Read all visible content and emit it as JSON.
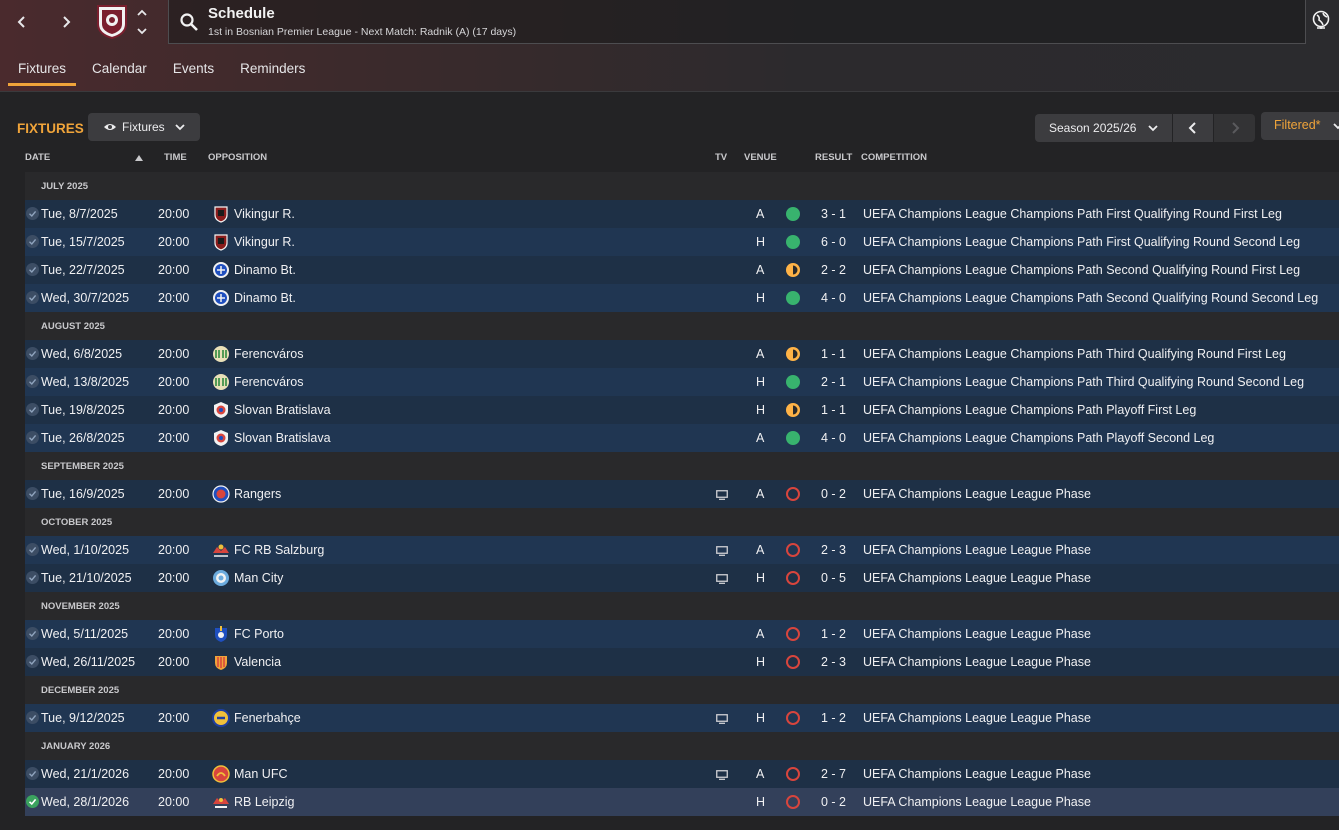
{
  "header": {
    "title": "Schedule",
    "subtitle": "1st in Bosnian Premier League - Next Match: Radnik (A) (17 days)"
  },
  "tabs": [
    "Fixtures",
    "Calendar",
    "Events",
    "Reminders"
  ],
  "section": {
    "title": "FIXTURES",
    "view_dropdown": "Fixtures",
    "season": "Season 2025/26",
    "filter": "Filtered*"
  },
  "columns": {
    "date": "DATE",
    "time": "TIME",
    "opposition": "OPPOSITION",
    "tv": "TV",
    "venue": "VENUE",
    "result": "RESULT",
    "competition": "COMPETITION"
  },
  "colors": {
    "accent": "#f0a43a",
    "win": "#38b36e",
    "draw": "#ffb347",
    "loss": "#d8453d"
  },
  "groups": [
    {
      "label": "JULY 2025",
      "fixtures": [
        {
          "date": "Tue, 8/7/2025",
          "time": "20:00",
          "opp": "Vikingur R.",
          "crest": "vikingur-crest-icon",
          "tv": false,
          "venue": "A",
          "outcome": "w",
          "result": "3 - 1",
          "comp": "UEFA Champions League Champions Path First Qualifying Round First Leg"
        },
        {
          "date": "Tue, 15/7/2025",
          "time": "20:00",
          "opp": "Vikingur R.",
          "crest": "vikingur-crest-icon",
          "tv": false,
          "venue": "H",
          "outcome": "w",
          "result": "6 - 0",
          "comp": "UEFA Champions League Champions Path First Qualifying Round Second Leg"
        },
        {
          "date": "Tue, 22/7/2025",
          "time": "20:00",
          "opp": "Dinamo Bt.",
          "crest": "dinamo-crest-icon",
          "tv": false,
          "venue": "A",
          "outcome": "d",
          "result": "2 - 2",
          "comp": "UEFA Champions League Champions Path Second Qualifying Round First Leg"
        },
        {
          "date": "Wed, 30/7/2025",
          "time": "20:00",
          "opp": "Dinamo Bt.",
          "crest": "dinamo-crest-icon",
          "tv": false,
          "venue": "H",
          "outcome": "w",
          "result": "4 - 0",
          "comp": "UEFA Champions League Champions Path Second Qualifying Round Second Leg"
        }
      ]
    },
    {
      "label": "AUGUST 2025",
      "fixtures": [
        {
          "date": "Wed, 6/8/2025",
          "time": "20:00",
          "opp": "Ferencváros",
          "crest": "ferencvaros-crest-icon",
          "tv": false,
          "venue": "A",
          "outcome": "d",
          "result": "1 - 1",
          "comp": "UEFA Champions League Champions Path Third Qualifying Round First Leg"
        },
        {
          "date": "Wed, 13/8/2025",
          "time": "20:00",
          "opp": "Ferencváros",
          "crest": "ferencvaros-crest-icon",
          "tv": false,
          "venue": "H",
          "outcome": "w",
          "result": "2 - 1",
          "comp": "UEFA Champions League Champions Path Third Qualifying Round Second Leg"
        },
        {
          "date": "Tue, 19/8/2025",
          "time": "20:00",
          "opp": "Slovan Bratislava",
          "crest": "slovan-crest-icon",
          "tv": false,
          "venue": "H",
          "outcome": "d",
          "result": "1 - 1",
          "comp": "UEFA Champions League Champions Path Playoff First Leg"
        },
        {
          "date": "Tue, 26/8/2025",
          "time": "20:00",
          "opp": "Slovan Bratislava",
          "crest": "slovan-crest-icon",
          "tv": false,
          "venue": "A",
          "outcome": "w",
          "result": "4 - 0",
          "comp": "UEFA Champions League Champions Path Playoff Second Leg"
        }
      ]
    },
    {
      "label": "SEPTEMBER 2025",
      "fixtures": [
        {
          "date": "Tue, 16/9/2025",
          "time": "20:00",
          "opp": "Rangers",
          "crest": "rangers-crest-icon",
          "tv": true,
          "venue": "A",
          "outcome": "l",
          "result": "0 - 2",
          "comp": "UEFA Champions League League Phase"
        }
      ]
    },
    {
      "label": "OCTOBER 2025",
      "fixtures": [
        {
          "date": "Wed, 1/10/2025",
          "time": "20:00",
          "opp": "FC RB Salzburg",
          "crest": "salzburg-crest-icon",
          "tv": true,
          "venue": "A",
          "outcome": "l",
          "result": "2 - 3",
          "comp": "UEFA Champions League League Phase"
        },
        {
          "date": "Tue, 21/10/2025",
          "time": "20:00",
          "opp": "Man City",
          "crest": "mancity-crest-icon",
          "tv": true,
          "venue": "H",
          "outcome": "l",
          "result": "0 - 5",
          "comp": "UEFA Champions League League Phase"
        }
      ]
    },
    {
      "label": "NOVEMBER 2025",
      "fixtures": [
        {
          "date": "Wed, 5/11/2025",
          "time": "20:00",
          "opp": "FC Porto",
          "crest": "porto-crest-icon",
          "tv": false,
          "venue": "A",
          "outcome": "l",
          "result": "1 - 2",
          "comp": "UEFA Champions League League Phase"
        },
        {
          "date": "Wed, 26/11/2025",
          "time": "20:00",
          "opp": "Valencia",
          "crest": "valencia-crest-icon",
          "tv": false,
          "venue": "H",
          "outcome": "l",
          "result": "2 - 3",
          "comp": "UEFA Champions League League Phase"
        }
      ]
    },
    {
      "label": "DECEMBER 2025",
      "fixtures": [
        {
          "date": "Tue, 9/12/2025",
          "time": "20:00",
          "opp": "Fenerbahçe",
          "crest": "fenerbahce-crest-icon",
          "tv": true,
          "venue": "H",
          "outcome": "l",
          "result": "1 - 2",
          "comp": "UEFA Champions League League Phase"
        }
      ]
    },
    {
      "label": "JANUARY 2026",
      "fixtures": [
        {
          "date": "Wed, 21/1/2026",
          "time": "20:00",
          "opp": "Man UFC",
          "crest": "manutd-crest-icon",
          "tv": true,
          "venue": "A",
          "outcome": "l",
          "result": "2 - 7",
          "comp": "UEFA Champions League League Phase"
        },
        {
          "date": "Wed, 28/1/2026",
          "time": "20:00",
          "opp": "RB Leipzig",
          "crest": "leipzig-crest-icon",
          "tv": false,
          "venue": "H",
          "outcome": "l",
          "result": "0 - 2",
          "comp": "UEFA Champions League League Phase",
          "done": true
        }
      ]
    }
  ]
}
